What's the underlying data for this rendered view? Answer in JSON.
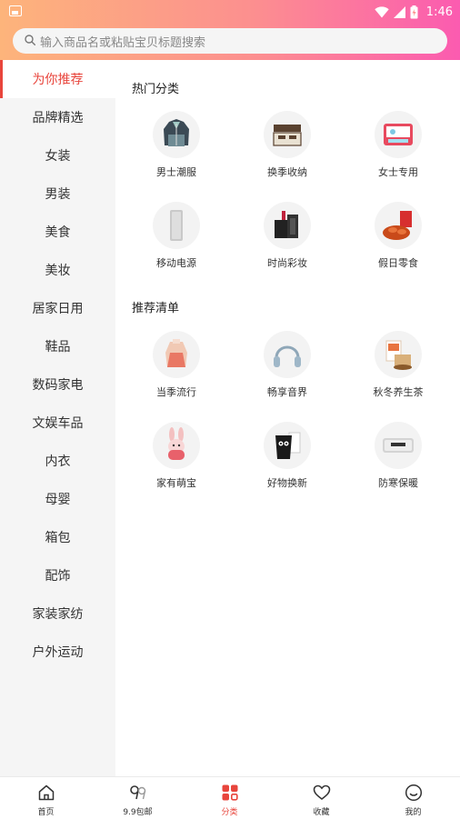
{
  "status_bar": {
    "time": "1:46"
  },
  "search": {
    "placeholder": "输入商品名或粘贴宝贝标题搜索"
  },
  "sidebar": {
    "items": [
      {
        "label": "为你推荐",
        "active": true
      },
      {
        "label": "品牌精选"
      },
      {
        "label": "女装"
      },
      {
        "label": "男装"
      },
      {
        "label": "美食"
      },
      {
        "label": "美妆"
      },
      {
        "label": "居家日用"
      },
      {
        "label": "鞋品"
      },
      {
        "label": "数码家电"
      },
      {
        "label": "文娱车品"
      },
      {
        "label": "内衣"
      },
      {
        "label": "母婴"
      },
      {
        "label": "箱包"
      },
      {
        "label": "配饰"
      },
      {
        "label": "家装家纺"
      },
      {
        "label": "户外运动"
      }
    ]
  },
  "hot": {
    "title": "热门分类",
    "items": [
      {
        "label": "男士潮服",
        "icon": "jacket-icon"
      },
      {
        "label": "换季收纳",
        "icon": "storage-box-icon"
      },
      {
        "label": "女士专用",
        "icon": "sanitary-pad-icon"
      },
      {
        "label": "移动电源",
        "icon": "power-bank-icon"
      },
      {
        "label": "时尚彩妆",
        "icon": "lipstick-icon"
      },
      {
        "label": "假日零食",
        "icon": "snack-icon"
      }
    ]
  },
  "recommend": {
    "title": "推荐清单",
    "items": [
      {
        "label": "当季流行",
        "icon": "sweater-icon"
      },
      {
        "label": "畅享音界",
        "icon": "headphones-icon"
      },
      {
        "label": "秋冬养生茶",
        "icon": "tea-icon"
      },
      {
        "label": "家有萌宝",
        "icon": "bunny-toy-icon"
      },
      {
        "label": "好物换新",
        "icon": "trash-bin-icon"
      },
      {
        "label": "防寒保暖",
        "icon": "heater-icon"
      }
    ]
  },
  "tabbar": {
    "items": [
      {
        "label": "首页",
        "icon": "home-icon"
      },
      {
        "label": "9.9包邮",
        "icon": "nine-nine-icon"
      },
      {
        "label": "分类",
        "icon": "category-grid-icon",
        "active": true
      },
      {
        "label": "收藏",
        "icon": "heart-icon"
      },
      {
        "label": "我的",
        "icon": "smiley-icon"
      }
    ]
  },
  "colors": {
    "accent": "#e8453c",
    "gradient_start": "#fdb47b",
    "gradient_end": "#fb5bb0"
  }
}
